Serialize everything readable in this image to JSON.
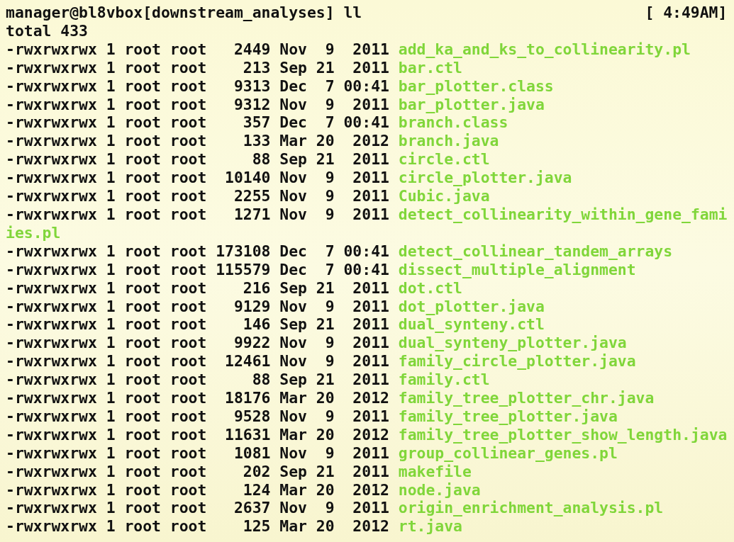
{
  "prompt": {
    "text": "manager@bl8vbox[downstream_analyses] ll",
    "clock": "[ 4:49AM]"
  },
  "total": "total 433",
  "files": [
    {
      "info": "-rwxrwxrwx 1 root root   2449 Nov  9  2011",
      "name": "add_ka_and_ks_to_collinearity.pl"
    },
    {
      "info": "-rwxrwxrwx 1 root root    213 Sep 21  2011",
      "name": "bar.ctl"
    },
    {
      "info": "-rwxrwxrwx 1 root root   9313 Dec  7 00:41",
      "name": "bar_plotter.class"
    },
    {
      "info": "-rwxrwxrwx 1 root root   9312 Nov  9  2011",
      "name": "bar_plotter.java"
    },
    {
      "info": "-rwxrwxrwx 1 root root    357 Dec  7 00:41",
      "name": "branch.class"
    },
    {
      "info": "-rwxrwxrwx 1 root root    133 Mar 20  2012",
      "name": "branch.java"
    },
    {
      "info": "-rwxrwxrwx 1 root root     88 Sep 21  2011",
      "name": "circle.ctl"
    },
    {
      "info": "-rwxrwxrwx 1 root root  10140 Nov  9  2011",
      "name": "circle_plotter.java"
    },
    {
      "info": "-rwxrwxrwx 1 root root   2255 Nov  9  2011",
      "name": "Cubic.java"
    },
    {
      "info": "-rwxrwxrwx 1 root root   1271 Nov  9  2011",
      "name": "detect_collinearity_within_gene_fami",
      "continuation": "ies.pl"
    },
    {
      "info": "-rwxrwxrwx 1 root root 173108 Dec  7 00:41",
      "name": "detect_collinear_tandem_arrays"
    },
    {
      "info": "-rwxrwxrwx 1 root root 115579 Dec  7 00:41",
      "name": "dissect_multiple_alignment"
    },
    {
      "info": "-rwxrwxrwx 1 root root    216 Sep 21  2011",
      "name": "dot.ctl"
    },
    {
      "info": "-rwxrwxrwx 1 root root   9129 Nov  9  2011",
      "name": "dot_plotter.java"
    },
    {
      "info": "-rwxrwxrwx 1 root root    146 Sep 21  2011",
      "name": "dual_synteny.ctl"
    },
    {
      "info": "-rwxrwxrwx 1 root root   9922 Nov  9  2011",
      "name": "dual_synteny_plotter.java"
    },
    {
      "info": "-rwxrwxrwx 1 root root  12461 Nov  9  2011",
      "name": "family_circle_plotter.java"
    },
    {
      "info": "-rwxrwxrwx 1 root root     88 Sep 21  2011",
      "name": "family.ctl"
    },
    {
      "info": "-rwxrwxrwx 1 root root  18176 Mar 20  2012",
      "name": "family_tree_plotter_chr.java"
    },
    {
      "info": "-rwxrwxrwx 1 root root   9528 Nov  9  2011",
      "name": "family_tree_plotter.java"
    },
    {
      "info": "-rwxrwxrwx 1 root root  11631 Mar 20  2012",
      "name": "family_tree_plotter_show_length.java"
    },
    {
      "info": "-rwxrwxrwx 1 root root   1081 Nov  9  2011",
      "name": "group_collinear_genes.pl"
    },
    {
      "info": "-rwxrwxrwx 1 root root    202 Sep 21  2011",
      "name": "makefile"
    },
    {
      "info": "-rwxrwxrwx 1 root root    124 Mar 20  2012",
      "name": "node.java"
    },
    {
      "info": "-rwxrwxrwx 1 root root   2637 Nov  9  2011",
      "name": "origin_enrichment_analysis.pl"
    },
    {
      "info": "-rwxrwxrwx 1 root root    125 Mar 20  2012",
      "name": "rt.java"
    }
  ]
}
